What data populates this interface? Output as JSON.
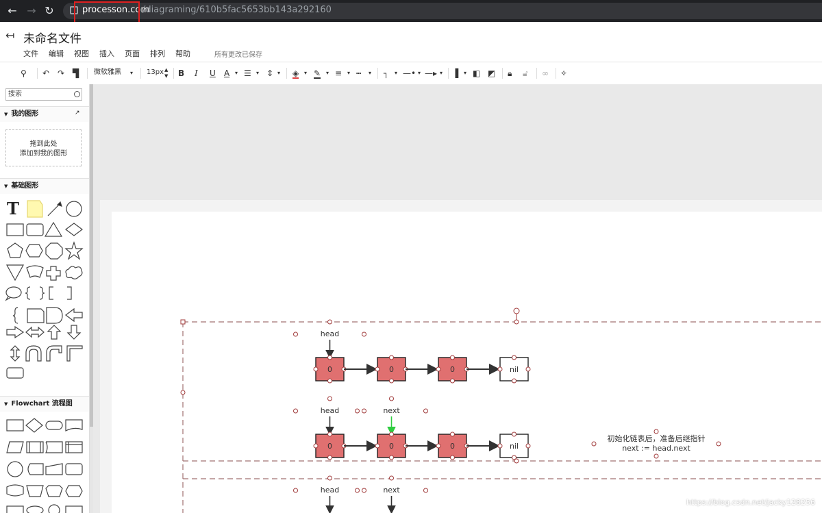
{
  "browser": {
    "url_host": "processon.com",
    "url_path": "/diagraming/610b5fac5653bb143a292160"
  },
  "header": {
    "title": "未命名文件",
    "save_status": "所有更改已保存",
    "menu": [
      "文件",
      "编辑",
      "视图",
      "插入",
      "页面",
      "排列",
      "帮助"
    ]
  },
  "toolbar": {
    "font_family": "微软雅黑",
    "font_size": "13px"
  },
  "sidebar": {
    "search_placeholder": "搜索",
    "my_shapes_title": "我的图形",
    "drop_hint_line1": "拖到此处",
    "drop_hint_line2": "添加到我的图形",
    "basic_shapes_title": "基础图形",
    "flowchart_title": "Flowchart 流程图"
  },
  "diagram": {
    "rows": [
      {
        "labels": [
          {
            "text": "head",
            "pos": 0
          }
        ],
        "nodes": [
          "0",
          "0",
          "0",
          "nil"
        ]
      },
      {
        "labels": [
          {
            "text": "head",
            "pos": 0
          },
          {
            "text": "next",
            "pos": 1
          }
        ],
        "nodes": [
          "0",
          "0",
          "0",
          "nil"
        ]
      },
      {
        "labels": [
          {
            "text": "head",
            "pos": 0
          },
          {
            "text": "next",
            "pos": 1
          }
        ],
        "nodes": []
      }
    ],
    "note_line1": "初始化链表后，准备后继指针",
    "note_line2": "next := head.next"
  },
  "colors": {
    "node_fill": "#e07070",
    "node_nil_fill": "#ffffff",
    "highlight_red": "#e02020",
    "handle_color": "#a03a3a"
  },
  "watermark": "https://blog.csdn.net/jacky128256"
}
